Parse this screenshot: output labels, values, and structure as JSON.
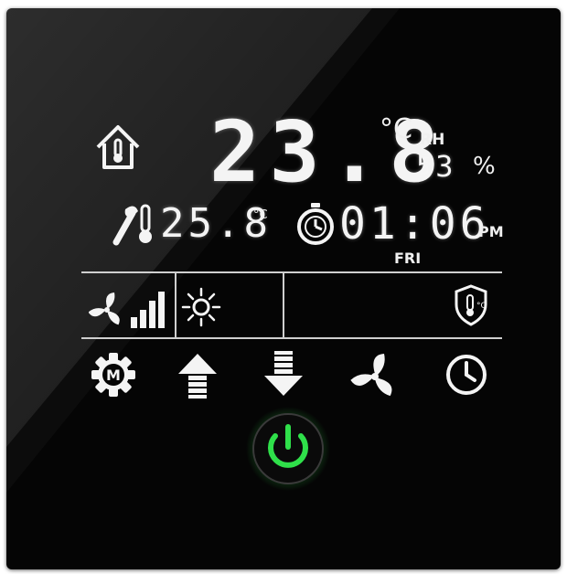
{
  "display": {
    "indoor_temp": "23.8",
    "indoor_unit": "°C",
    "humidity_label": "RH",
    "humidity_value": "53",
    "humidity_unit": "%",
    "setpoint_temp": "25.8",
    "setpoint_unit": "°C",
    "clock_time": "01:06",
    "clock_ampm": "PM",
    "clock_day": "FRI"
  },
  "status": {
    "fan_speed_level": 4,
    "fan_speed_max": 4,
    "mode": "heating-sun-icon",
    "protection": "thermometer-shield-icon"
  },
  "controls": [
    {
      "name": "mode-gear-button",
      "icon": "gear-m-icon"
    },
    {
      "name": "temp-up-button",
      "icon": "arrow-up-icon"
    },
    {
      "name": "temp-down-button",
      "icon": "arrow-down-icon"
    },
    {
      "name": "fan-button",
      "icon": "fan-icon"
    },
    {
      "name": "timer-button",
      "icon": "clock-icon"
    },
    {
      "name": "power-button",
      "icon": "power-icon"
    }
  ],
  "colors": {
    "background": "#050505",
    "segment": "#f4f4f4",
    "power_glow": "#2fe04a"
  }
}
